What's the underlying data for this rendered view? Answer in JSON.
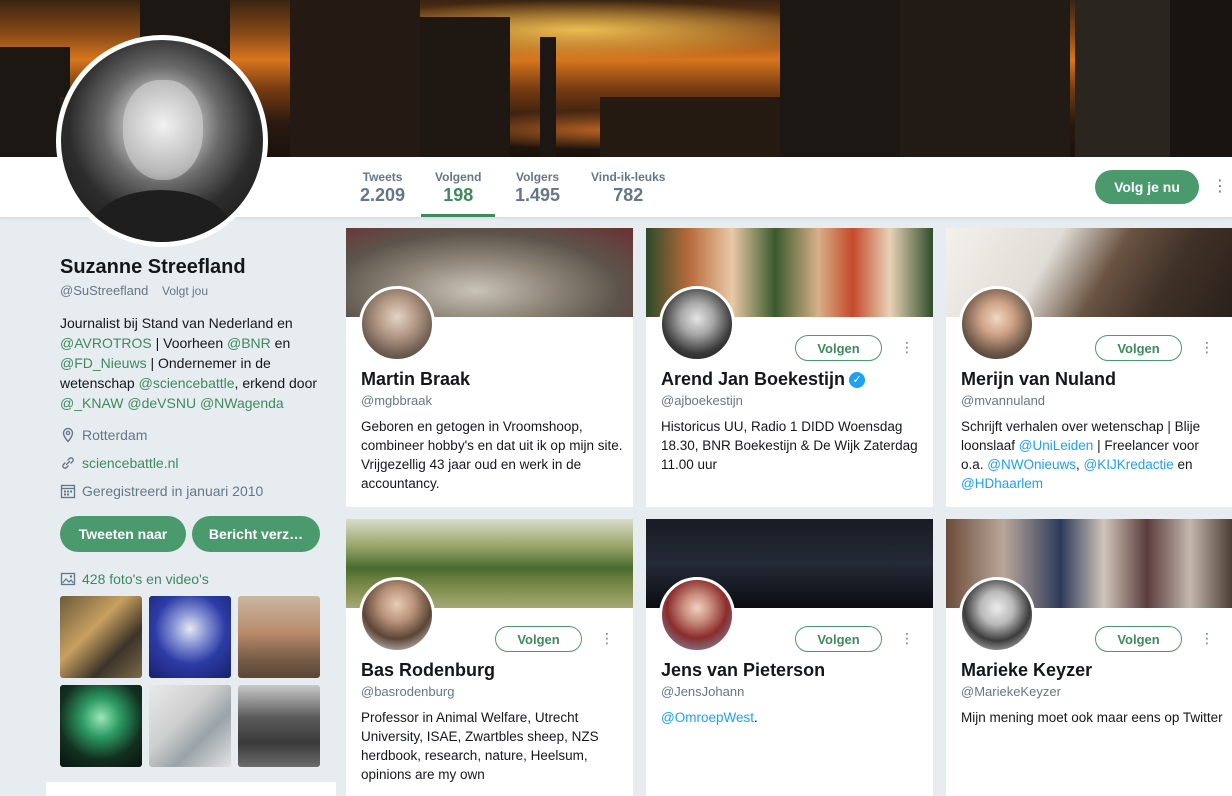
{
  "profile": {
    "name": "Suzanne Streefland",
    "handle": "@SuStreefland",
    "follows_you": "Volgt jou",
    "bio_parts": {
      "p1": "Journalist bij Stand van Nederland en ",
      "m_avrotros": "@AVROTROS",
      "p2": " | Voorheen ",
      "m_bnr": "@BNR",
      "p3": " en ",
      "m_fd": "@FD_Nieuws",
      "p4": " | Ondernemer in de wetenschap ",
      "m_sb": "@sciencebattle",
      "p5": ", erkend door ",
      "m_knaw": "@_KNAW",
      "m_devsnu": "@deVSNU",
      "m_nwa": "@NWagenda"
    },
    "location": "Rotterdam",
    "website": "sciencebattle.nl",
    "joined": "Geregistreerd in januari 2010",
    "tweet_to_label": "Tweeten naar",
    "message_label": "Bericht verz…",
    "media_label": "428 foto's en video's"
  },
  "nav": {
    "stats": [
      {
        "label": "Tweets",
        "value": "2.209"
      },
      {
        "label": "Volgend",
        "value": "198"
      },
      {
        "label": "Volgers",
        "value": "1.495"
      },
      {
        "label": "Vind-ik-leuks",
        "value": "782"
      }
    ],
    "active_index": 1,
    "follow_label": "Volg je nu"
  },
  "cards": [
    {
      "name": "Martin Braak",
      "handle": "@mgbbraak",
      "bio": "Geboren en getogen in Vroomshoop, combineer hobby's en dat uit ik op mijn site. Vrijgezellig 43 jaar oud en werk in de accountancy.",
      "follow_label": ""
    },
    {
      "name": "Arend Jan Boekestijn",
      "handle": "@ajboekestijn",
      "verified": true,
      "bio": "Historicus UU, Radio 1 DIDD Woensdag 18.30, BNR Boekestijn & De Wijk Zaterdag 11.00 uur",
      "follow_label": "Volgen"
    },
    {
      "name": "Merijn van Nuland",
      "handle": "@mvannuland",
      "bio_parts": {
        "p1": "Schrijft verhalen over wetenschap | Blije loonslaaf ",
        "m1": "@UniLeiden",
        "p2": " | Freelancer voor o.a. ",
        "m2": "@NWOnieuws",
        "p3": ", ",
        "m3": "@KIJKredactie",
        "p4": " en ",
        "m4": "@HDhaarlem"
      },
      "follow_label": "Volgen"
    },
    {
      "name": "Bas Rodenburg",
      "handle": "@basrodenburg",
      "bio": "Professor in Animal Welfare, Utrecht University, ISAE, Zwartbles sheep, NZS herdbook, research, nature, Heelsum, opinions are my own",
      "follow_label": "Volgen"
    },
    {
      "name": "Jens van Pieterson",
      "handle": "@JensJohann",
      "bio_parts": {
        "m1": "@OmroepWest",
        "p1": "."
      },
      "follow_label": "Volgen"
    },
    {
      "name": "Marieke Keyzer",
      "handle": "@MariekeKeyzer",
      "bio": "Mijn mening moet ook maar eens op Twitter",
      "follow_label": "Volgen"
    }
  ],
  "colors": {
    "accent": "#3e8a5e",
    "button": "#4b9a6d",
    "link_blue": "#1da1f2",
    "bg": "#e6ecf0"
  },
  "icons": {
    "location": "location-pin-icon",
    "website": "link-icon",
    "joined": "calendar-icon",
    "media": "image-icon",
    "more": "more-vertical-icon",
    "verified": "verified-badge-icon"
  }
}
